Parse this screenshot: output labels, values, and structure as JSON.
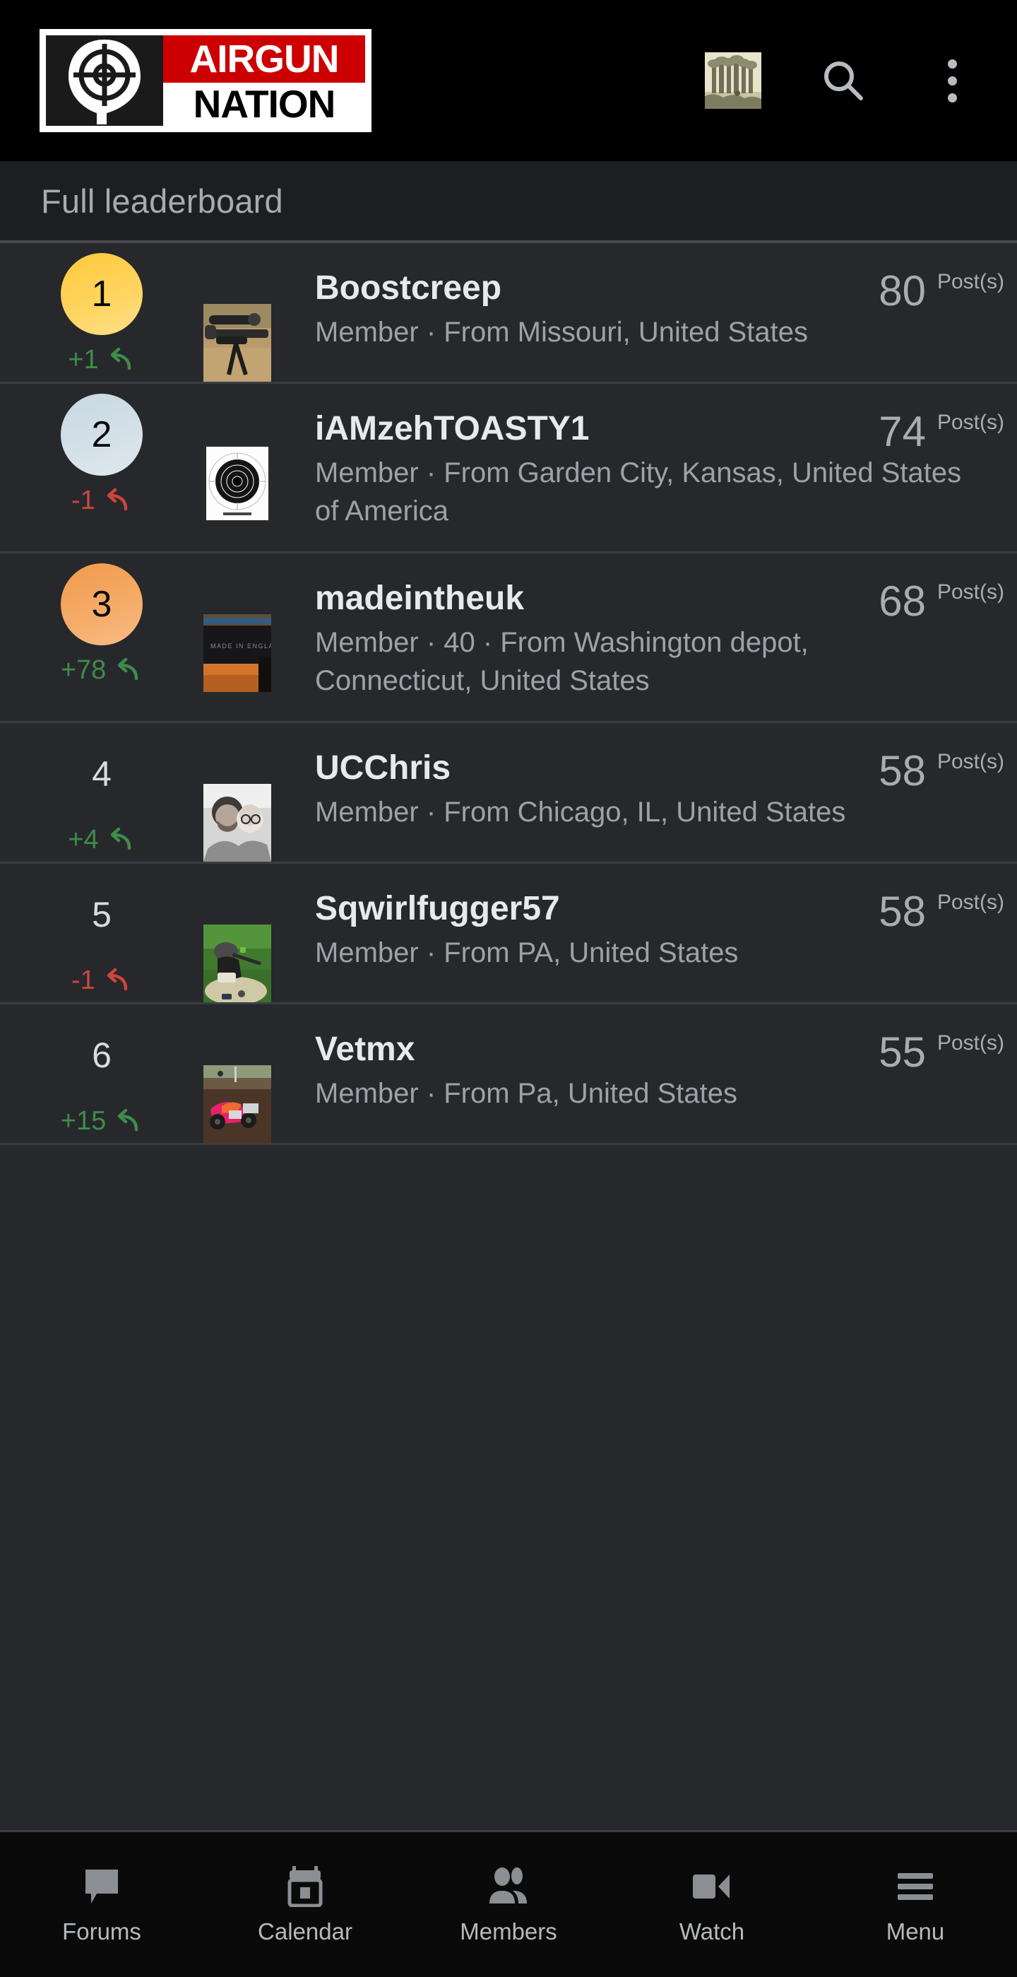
{
  "appbar": {
    "logo": {
      "word_top": "AIRGUN",
      "word_bottom": "NATION",
      "mark_icon": "crosshair-target-icon",
      "red_hex": "#cc0000"
    },
    "user_avatar_icon": "user-avatar-thumbnail",
    "search_icon": "search-icon",
    "overflow_icon": "overflow-menu-icon"
  },
  "section": {
    "title": "Full leaderboard"
  },
  "leaderboard": {
    "post_label": "Post(s)",
    "rows": [
      {
        "rank": "1",
        "badge_style": "gold",
        "badge_hex": "#ffc93c",
        "delta": "+1",
        "delta_direction": "up",
        "delta_icon": "return-arrow-icon",
        "avatar_icon": "avatar-airgun-rifle-bipod",
        "username": "Boostcreep",
        "meta": "Member · From Missouri, United States",
        "posts": "80"
      },
      {
        "rank": "2",
        "badge_style": "silver",
        "badge_hex": "#cfdce4",
        "delta": "-1",
        "delta_direction": "down",
        "delta_icon": "return-arrow-icon",
        "avatar_icon": "avatar-paper-shooting-target",
        "username": "iAMzehTOASTY1",
        "meta": "Member · From Garden City, Kansas, United States of America",
        "posts": "74"
      },
      {
        "rank": "3",
        "badge_style": "bronze",
        "badge_hex": "#f0a05a",
        "delta": "+78",
        "delta_direction": "up",
        "delta_icon": "return-arrow-icon",
        "avatar_icon": "avatar-made-in-england-barrel",
        "username": "madeintheuk",
        "meta": "Member · 40 · From Washington depot, Connecticut, United States",
        "posts": "68"
      },
      {
        "rank": "4",
        "badge_style": "plain",
        "badge_hex": "#d9dcde",
        "delta": "+4",
        "delta_direction": "up",
        "delta_icon": "return-arrow-icon",
        "avatar_icon": "avatar-couple-photo-bw",
        "username": "UCChris",
        "meta": "Member · From Chicago, IL, United States",
        "posts": "58"
      },
      {
        "rank": "5",
        "badge_style": "plain",
        "badge_hex": "#d9dcde",
        "delta": "-1",
        "delta_direction": "down",
        "delta_icon": "return-arrow-icon",
        "avatar_icon": "avatar-prone-shooter-grass",
        "username": "Sqwirlfugger57",
        "meta": "Member · From PA, United States",
        "posts": "58"
      },
      {
        "rank": "6",
        "badge_style": "plain",
        "badge_hex": "#d9dcde",
        "delta": "+15",
        "delta_direction": "up",
        "delta_icon": "return-arrow-icon",
        "avatar_icon": "avatar-motocross-dirt-track",
        "username": "Vetmx",
        "meta": "Member · From Pa, United States",
        "posts": "55"
      }
    ]
  },
  "bottomnav": {
    "items": [
      {
        "label": "Forums",
        "icon": "chat-bubble-icon"
      },
      {
        "label": "Calendar",
        "icon": "calendar-icon"
      },
      {
        "label": "Members",
        "icon": "people-icon"
      },
      {
        "label": "Watch",
        "icon": "video-camera-icon"
      },
      {
        "label": "Menu",
        "icon": "hamburger-menu-icon"
      }
    ]
  },
  "colors": {
    "page_bg": "#26282c",
    "appbar_bg": "#000000",
    "section_bg": "#1c1e22",
    "divider": "#3a3e44",
    "text_primary": "#e7eaec",
    "text_secondary": "#9ea2a7",
    "up_green": "#3e8c48",
    "down_red": "#d0443f"
  }
}
